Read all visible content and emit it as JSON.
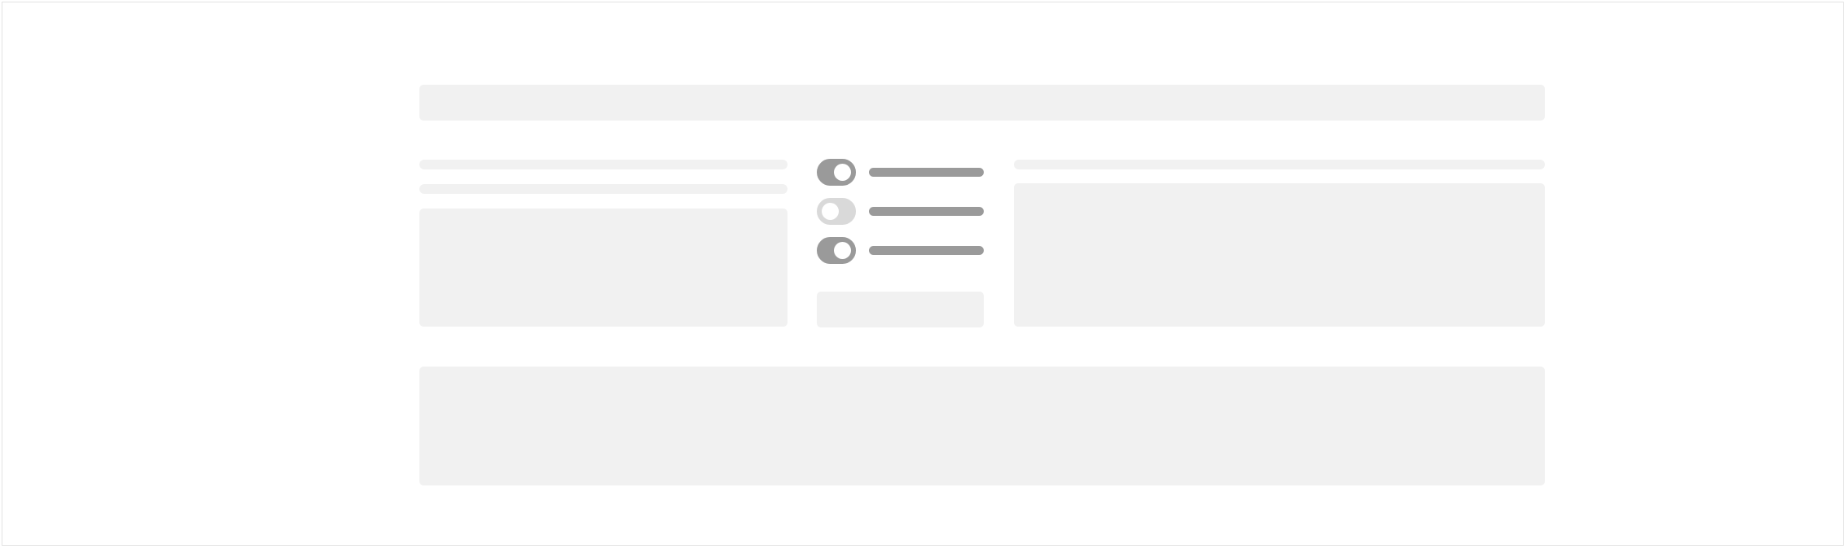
{
  "header": {
    "title": ""
  },
  "left_panel": {
    "line_1": "",
    "line_2": "",
    "body": ""
  },
  "toggles": [
    {
      "label": "",
      "state": "on"
    },
    {
      "label": "",
      "state": "off"
    },
    {
      "label": "",
      "state": "on"
    }
  ],
  "action_button": {
    "label": ""
  },
  "right_panel": {
    "title": "",
    "body": ""
  },
  "footer": {
    "body": ""
  },
  "colors": {
    "placeholder": "#f1f1f1",
    "toggle_on": "#9a9a9a",
    "toggle_off": "#d9d9d9",
    "border": "#e3e3e3"
  }
}
